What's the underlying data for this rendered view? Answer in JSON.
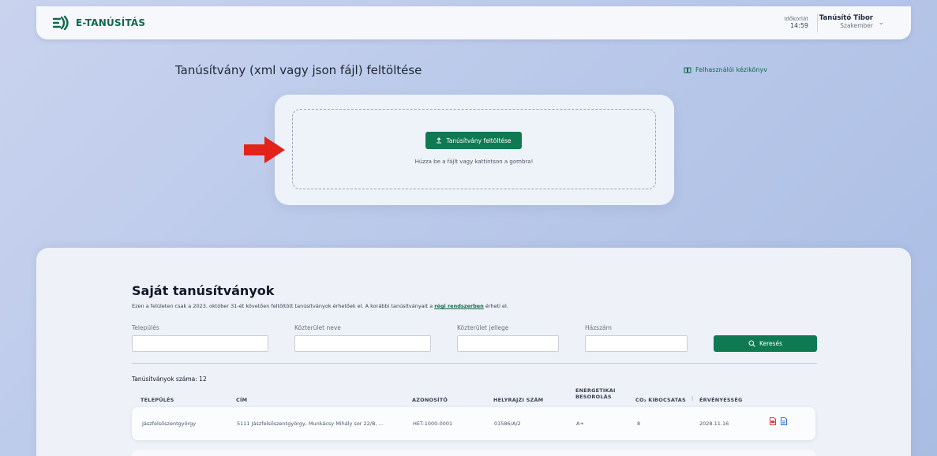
{
  "header": {
    "brand": "E-TANÚSÍTÁS",
    "timer_label": "Időkorlát",
    "timer_value": "14:59",
    "user_name": "Tanúsító Tibor",
    "user_role": "Szakember"
  },
  "upload": {
    "title": "Tanúsítvány (xml vagy json fájl) feltöltése",
    "manual_link": "Felhasználói kézikönyv",
    "button_label": "Tanúsítvány feltöltése",
    "hint": "Húzza be a fájlt vagy kattintson a gombra!"
  },
  "certificates": {
    "title": "Saját tanúsítványok",
    "subtitle_before": "Ezen a felületen csak a 2023. október 31-ét követően feltöltött tanúsítványok érhetőek el. A korábbi tanúsítványait a",
    "subtitle_link": "régi rendszerben",
    "subtitle_after": "érheti el.",
    "filters": {
      "settlement_label": "Település",
      "street_label": "Közterület neve",
      "street_type_label": "Közterület jellege",
      "house_number_label": "Házszám",
      "search_button": "Keresés"
    },
    "count_text": "Tanúsítványok száma: 12",
    "columns": {
      "settlement": "TELEPÜLÉS",
      "address": "CÍM",
      "identifier": "AZONOSÍTÓ",
      "parcel": "HELYRAJZI SZÁM",
      "energy_line1": "ENERGETIKAI",
      "energy_line2": "BESOROLÁS",
      "co2": "CO₂ KIBOCSÁTÁS",
      "validity": "ÉRVÉNYESSÉG"
    },
    "rows": [
      {
        "settlement": "Jászfelsőszentgyörgy",
        "address": "5111 Jászfelsőszentgyörgy, Munkácsy Mihály sor 22/B, ...",
        "identifier": "HET-1000-0001",
        "parcel": "01586/A/2",
        "energy": "A+",
        "co2": "8",
        "validity": "2028.11.16"
      }
    ]
  },
  "colors": {
    "brand_green": "#0f7a52",
    "arrow_red": "#e2231a",
    "pdf_red": "#d9363e",
    "doc_blue": "#2f6fd6"
  },
  "icons": [
    "logo-icon",
    "book-icon",
    "upload-icon",
    "arrow-right-icon",
    "search-icon",
    "pdf-icon",
    "document-icon",
    "chevron-down-icon"
  ]
}
